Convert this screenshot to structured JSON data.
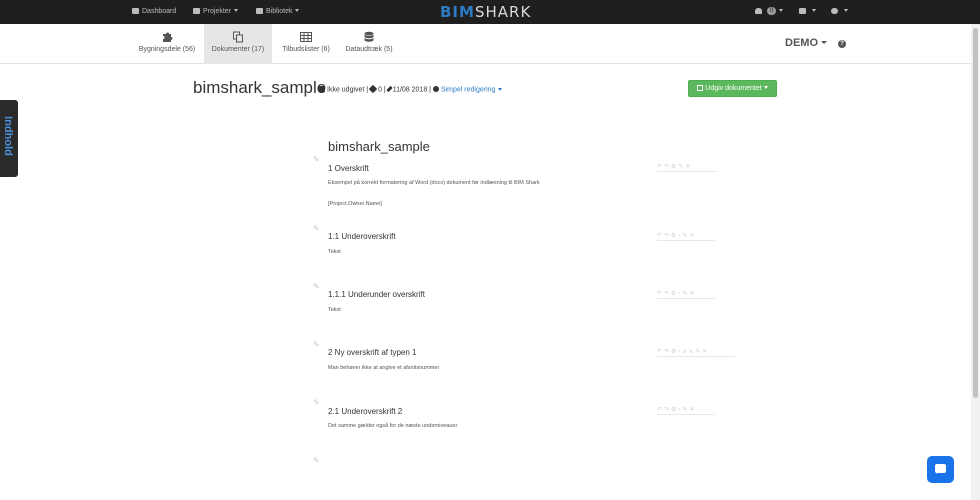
{
  "topnav": {
    "dashboard": "Dashboard",
    "projects": "Projekter",
    "library": "Bibliotek",
    "brand_part1": "BIM",
    "brand_part2": "SHARK",
    "notifications_count": "0"
  },
  "subnav": {
    "tabs": [
      {
        "label": "Bygningsdele (56)",
        "icon": "puzzle-icon"
      },
      {
        "label": "Dokumenter (17)",
        "icon": "documents-icon"
      },
      {
        "label": "Tilbudslister (6)",
        "icon": "table-icon"
      },
      {
        "label": "Dataudtræk (5)",
        "icon": "database-icon"
      }
    ],
    "workspace": "DEMO"
  },
  "sidebar_tab": "Indhold",
  "document": {
    "title": "bimshark_sample",
    "status": "Ikke udgivet",
    "tags": "0",
    "date": "11/08 2018",
    "edit_mode": "Simpel redigering",
    "publish_button": "Udgiv dokumentet"
  },
  "content": {
    "title": "bimshark_sample",
    "sections": [
      {
        "heading": "1 Overskrift",
        "text": "Eksempel på korrekt formatering af Word (docx) dokument før indlæsning til BIM Shark",
        "extra": "[Project.Owner.Name]"
      },
      {
        "heading": "1.1 Underoverskrift",
        "text": "Tekst"
      },
      {
        "heading": "1.1.1 Underunder overskrift",
        "text": "Tekst"
      },
      {
        "heading": "2 Ny overskrift af typen 1",
        "text": "Man behøver ikke at angive et afsnitsnummer"
      },
      {
        "heading": "2.1 Underoverskrift 2",
        "text": "Det samme gælder også for de næste underniveauer"
      }
    ]
  }
}
